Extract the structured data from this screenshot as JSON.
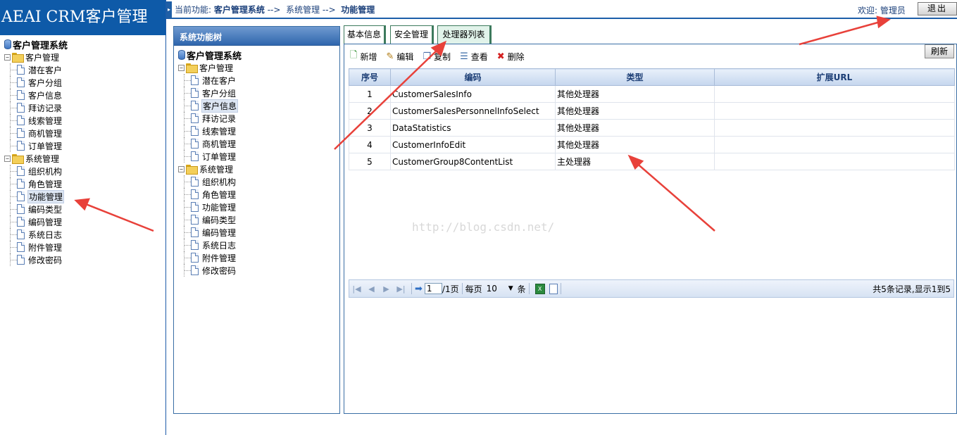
{
  "app": {
    "title": "AEAI CRM客户管理"
  },
  "left_tree": {
    "root": "客户管理系统",
    "groups": [
      {
        "label": "客户管理",
        "items": [
          "潜在客户",
          "客户分组",
          "客户信息",
          "拜访记录",
          "线索管理",
          "商机管理",
          "订单管理"
        ]
      },
      {
        "label": "系统管理",
        "items": [
          "组织机构",
          "角色管理",
          "功能管理",
          "编码类型",
          "编码管理",
          "系统日志",
          "附件管理",
          "修改密码"
        ]
      }
    ],
    "selected": "功能管理"
  },
  "topbar": {
    "prefix": "当前功能:",
    "crumb1": "客户管理系统",
    "sep1": "-->",
    "crumb2": "系统管理",
    "sep2": "-->",
    "crumb3": "功能管理",
    "welcome": "欢迎: 管理员",
    "logout": "退出"
  },
  "sys_panel": {
    "title": "系统功能树",
    "root": "客户管理系统",
    "groups": [
      {
        "label": "客户管理",
        "items": [
          "潜在客户",
          "客户分组",
          "客户信息",
          "拜访记录",
          "线索管理",
          "商机管理",
          "订单管理"
        ]
      },
      {
        "label": "系统管理",
        "items": [
          "组织机构",
          "角色管理",
          "功能管理",
          "编码类型",
          "编码管理",
          "系统日志",
          "附件管理",
          "修改密码"
        ]
      }
    ],
    "selected": "客户信息"
  },
  "tabs": [
    {
      "label": "基本信息",
      "active": false
    },
    {
      "label": "安全管理",
      "active": false
    },
    {
      "label": "处理器列表",
      "active": true
    }
  ],
  "toolbar": {
    "add": "新增",
    "edit": "编辑",
    "copy": "复制",
    "view": "查看",
    "delete": "删除",
    "refresh": "刷新"
  },
  "grid": {
    "columns": [
      "序号",
      "编码",
      "类型",
      "扩展URL"
    ],
    "rows": [
      [
        "1",
        "CustomerSalesInfo",
        "其他处理器",
        ""
      ],
      [
        "2",
        "CustomerSalesPersonnelInfoSelect",
        "其他处理器",
        ""
      ],
      [
        "3",
        "DataStatistics",
        "其他处理器",
        ""
      ],
      [
        "4",
        "CustomerInfoEdit",
        "其他处理器",
        ""
      ],
      [
        "5",
        "CustomerGroup8ContentList",
        "主处理器",
        ""
      ]
    ]
  },
  "pager": {
    "page": "1",
    "total_pages": "/1页",
    "per_page_label": "每页",
    "per_page": "10",
    "unit": "条",
    "info": "共5条记录,显示1到5"
  },
  "watermark": "http://blog.csdn.net/",
  "colors": {
    "header_blue": "#0e5aa8",
    "annotation_red": "#e8413a"
  }
}
